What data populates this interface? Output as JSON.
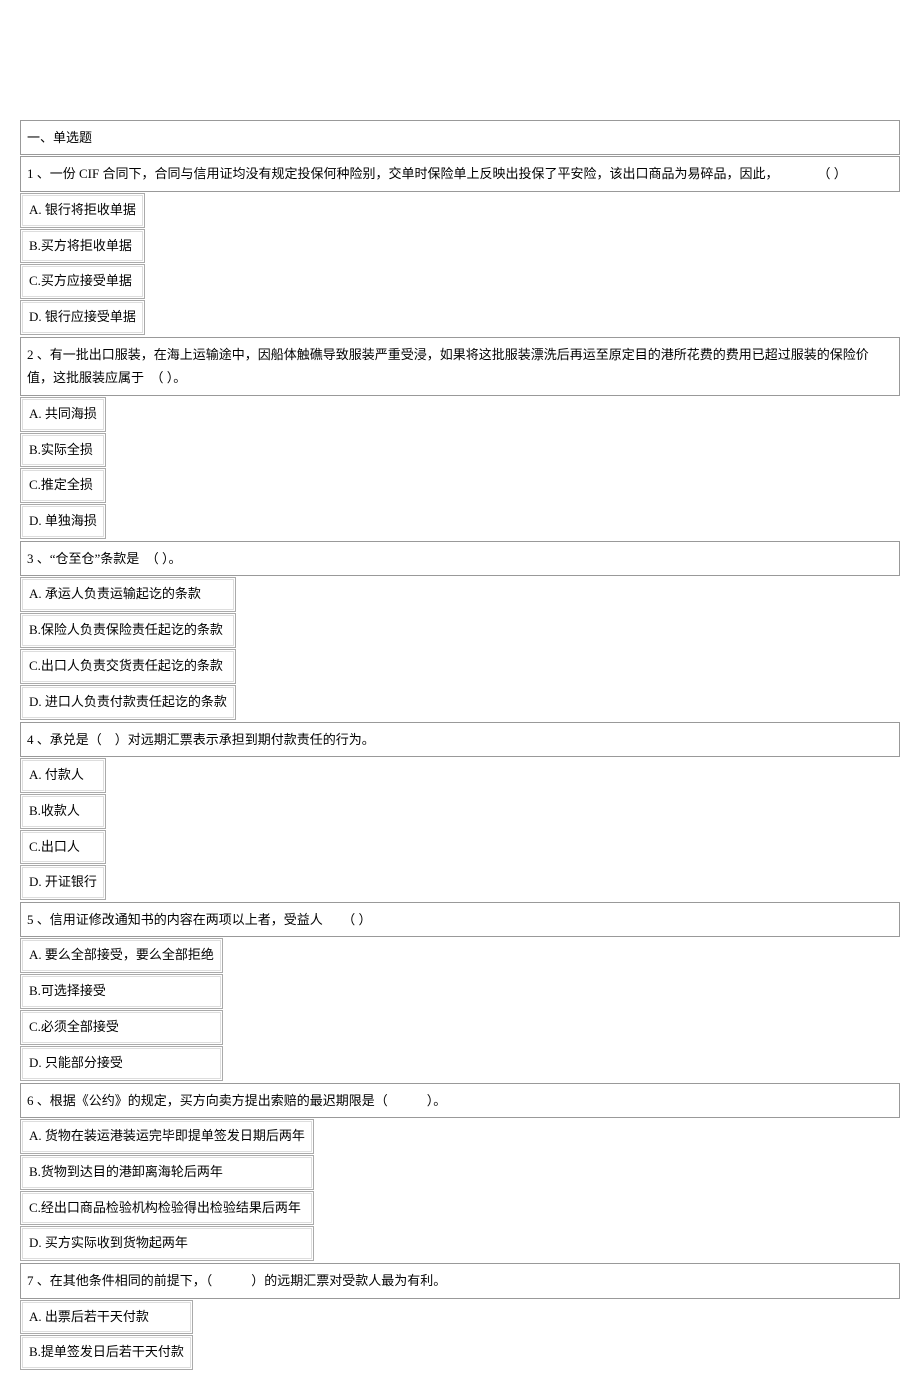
{
  "section_heading": "一、单选题",
  "questions": [
    {
      "stem": "1 、一份 CIF 合同下，合同与信用证均没有规定投保何种险别，交单时保险单上反映出投保了平安险，该出口商品为易碎品，因此，　　　　（ ）",
      "options": [
        "A. 银行将拒收单据",
        "B.买方将拒收单据",
        "C.买方应接受单据",
        "D. 银行应接受单据"
      ]
    },
    {
      "stem": "2 、有一批出口服装，在海上运输途中，因船体触礁导致服装严重受浸，如果将这批服装漂洗后再运至原定目的港所花费的费用已超过服装的保险价值，这批服装应属于　（ ）。",
      "options": [
        "A. 共同海损",
        "B.实际全损",
        "C.推定全损",
        "D. 单独海损"
      ]
    },
    {
      "stem": "3 、“仓至仓”条款是　（ ）。",
      "options": [
        "A. 承运人负责运输起讫的条款",
        "B.保险人负责保险责任起讫的条款",
        "C.出口人负责交货责任起讫的条款",
        "D. 进口人负责付款责任起讫的条款"
      ]
    },
    {
      "stem": "4 、承兑是（　）对远期汇票表示承担到期付款责任的行为。",
      "options": [
        "A. 付款人",
        "B.收款人",
        "C.出口人",
        "D. 开证银行"
      ]
    },
    {
      "stem": "5 、信用证修改通知书的内容在两项以上者，受益人　　（ ）",
      "options": [
        "A. 要么全部接受，要么全部拒绝",
        "B.可选择接受",
        "C.必须全部接受",
        "D. 只能部分接受"
      ]
    },
    {
      "stem": "6 、根据《公约》的规定，买方向卖方提出索赔的最迟期限是（　　　）。",
      "options": [
        "A. 货物在装运港装运完毕即提单签发日期后两年",
        "B.货物到达目的港卸离海轮后两年",
        "C.经出口商品检验机构检验得出检验结果后两年",
        "D. 买方实际收到货物起两年"
      ]
    },
    {
      "stem": "7 、在其他条件相同的前提下，（　　　）的远期汇票对受款人最为有利。",
      "options": [
        "A. 出票后若干天付款",
        "B.提单签发日后若干天付款"
      ]
    }
  ]
}
